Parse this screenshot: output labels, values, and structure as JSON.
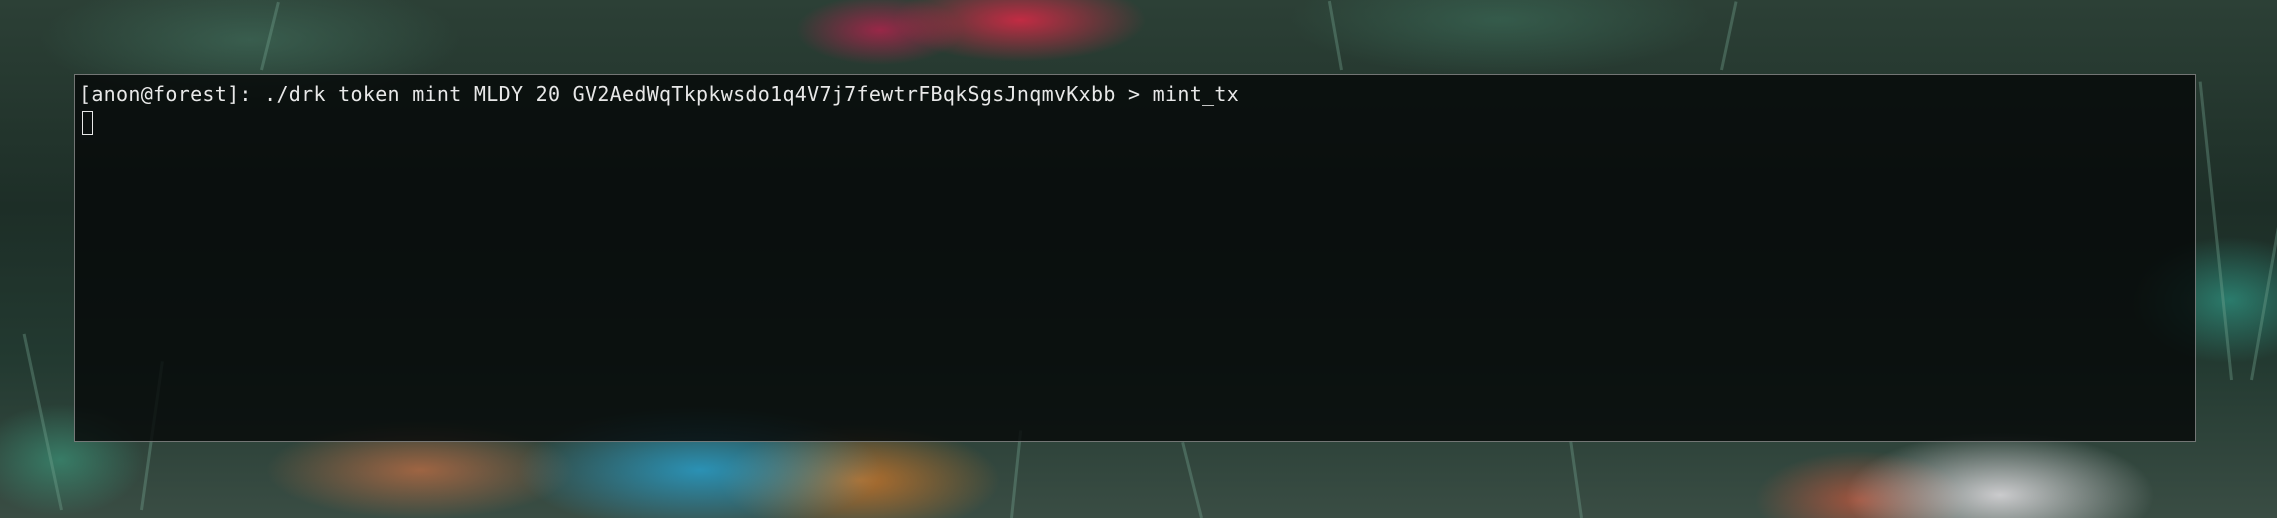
{
  "terminal": {
    "prompt": "[anon@forest]: ",
    "command": "./drk token mint MLDY 20 GV2AedWqTkpkwsdo1q4V7j7fewtrFBqkSgsJnqmvKxbb > mint_tx"
  },
  "colors": {
    "terminal_background": "#060808",
    "terminal_text": "#e8e8e8",
    "terminal_border": "#c8c8c8"
  }
}
